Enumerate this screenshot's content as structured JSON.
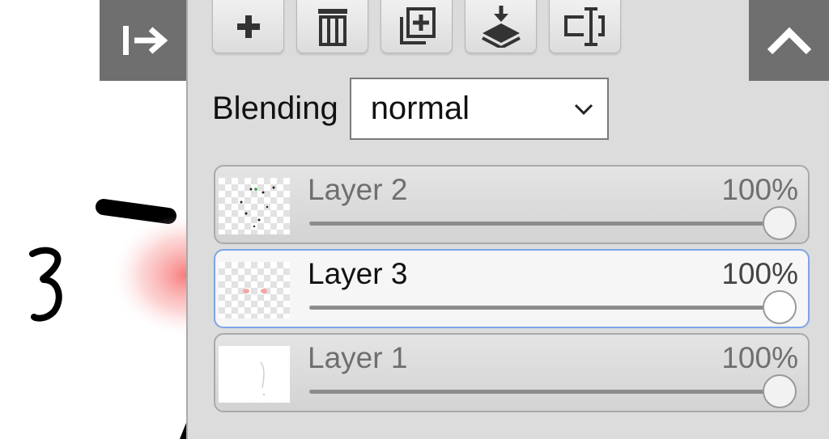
{
  "toolbar": {
    "buttons": [
      {
        "icon": "plus-icon",
        "label": "add layer"
      },
      {
        "icon": "trash-icon",
        "label": "delete layer"
      },
      {
        "icon": "duplicate-icon",
        "label": "duplicate layer"
      },
      {
        "icon": "merge-down-icon",
        "label": "merge down"
      },
      {
        "icon": "rename-icon",
        "label": "rename layer"
      }
    ]
  },
  "panel_controls": {
    "collapse_icon": "collapse-right-icon",
    "up_icon": "chevron-up-icon"
  },
  "blending": {
    "label": "Blending",
    "value": "normal"
  },
  "layers": [
    {
      "name": "Layer 2",
      "opacity": "100%",
      "opacity_value": 1.0,
      "active": false
    },
    {
      "name": "Layer 3",
      "opacity": "100%",
      "opacity_value": 1.0,
      "active": true
    },
    {
      "name": "Layer 1",
      "opacity": "100%",
      "opacity_value": 1.0,
      "active": false
    }
  ],
  "canvas": {
    "glyph": "3"
  },
  "colors": {
    "panel_bg": "#dcdcdc",
    "dark_button": "#6f6f6f",
    "active_border": "#7ea4e6"
  }
}
